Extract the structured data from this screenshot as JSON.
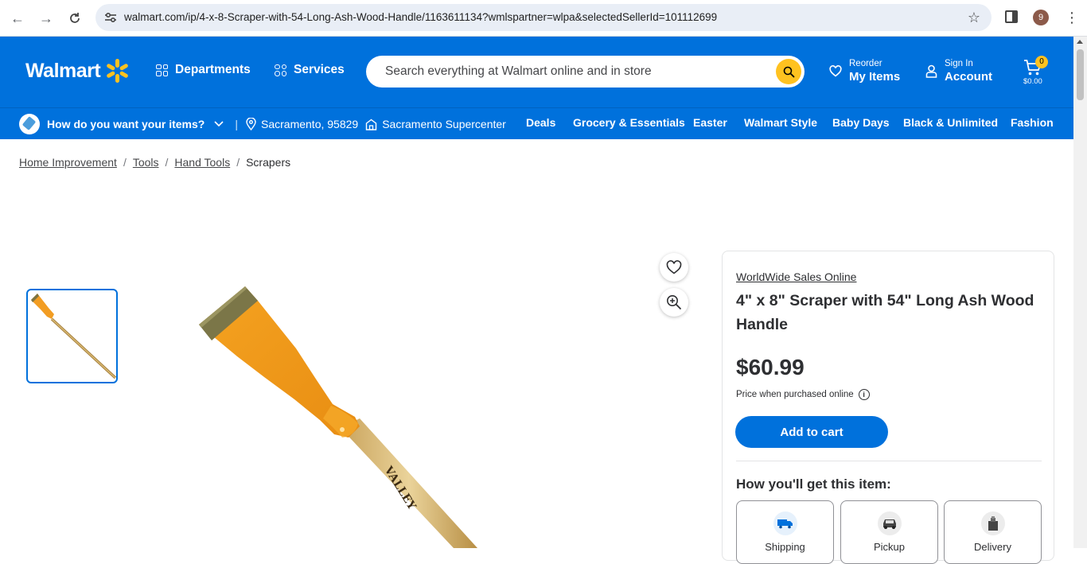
{
  "browser": {
    "url": "walmart.com/ip/4-x-8-Scraper-with-54-Long-Ash-Wood-Handle/1163611134?wmlspartner=wlpa&selectedSellerId=101112699",
    "profile_initial": "9"
  },
  "header": {
    "logo_text": "Walmart",
    "departments_label": "Departments",
    "services_label": "Services",
    "search_placeholder": "Search everything at Walmart online and in store",
    "reorder_small": "Reorder",
    "reorder_big": "My Items",
    "signin_small": "Sign In",
    "signin_big": "Account",
    "cart_count": "0",
    "cart_total": "$0.00",
    "brand_blue": "#0071dc",
    "spark_yellow": "#ffc220"
  },
  "subnav": {
    "fulfillment_prompt": "How do you want your items?",
    "location": "Sacramento, 95829",
    "store": "Sacramento Supercenter",
    "categories": [
      "Deals",
      "Grocery & Essentials",
      "Easter",
      "Walmart Style",
      "Baby Days",
      "Black & Unlimited",
      "Fashion"
    ]
  },
  "breadcrumb": {
    "items": [
      "Home Improvement",
      "Tools",
      "Hand Tools"
    ],
    "current": "Scrapers"
  },
  "product": {
    "seller": "WorldWide Sales Online",
    "title": "4\" x 8\" Scraper with 54\" Long Ash Wood Handle",
    "price": "$60.99",
    "price_note": "Price when purchased online",
    "add_to_cart": "Add to cart",
    "how_get_heading": "How you'll get this item:",
    "fulfillment_options": [
      "Shipping",
      "Pickup",
      "Delivery"
    ],
    "handle_brand": "VALLEY"
  }
}
